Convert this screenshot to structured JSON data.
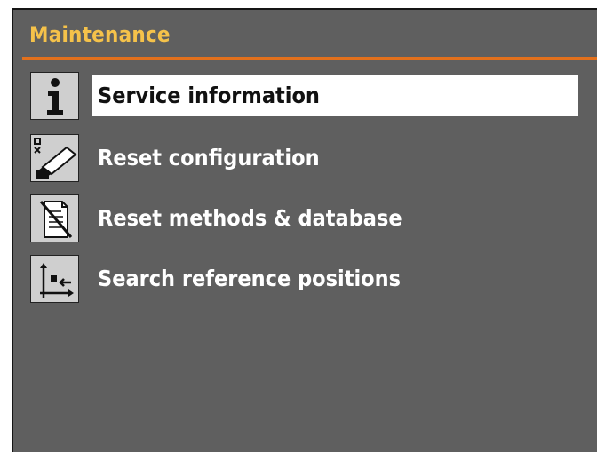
{
  "screen": {
    "title": "Maintenance",
    "accent_color": "#e2701c",
    "title_color": "#f5c24a",
    "background_color": "#5f5f5f"
  },
  "menu": {
    "items": [
      {
        "label": "Service information",
        "icon": "info-icon",
        "selected": true
      },
      {
        "label": "Reset configuration",
        "icon": "reset-configuration-icon",
        "selected": false
      },
      {
        "label": "Reset methods & database",
        "icon": "reset-database-icon",
        "selected": false
      },
      {
        "label": "Search reference positions",
        "icon": "reference-positions-icon",
        "selected": false
      }
    ]
  }
}
